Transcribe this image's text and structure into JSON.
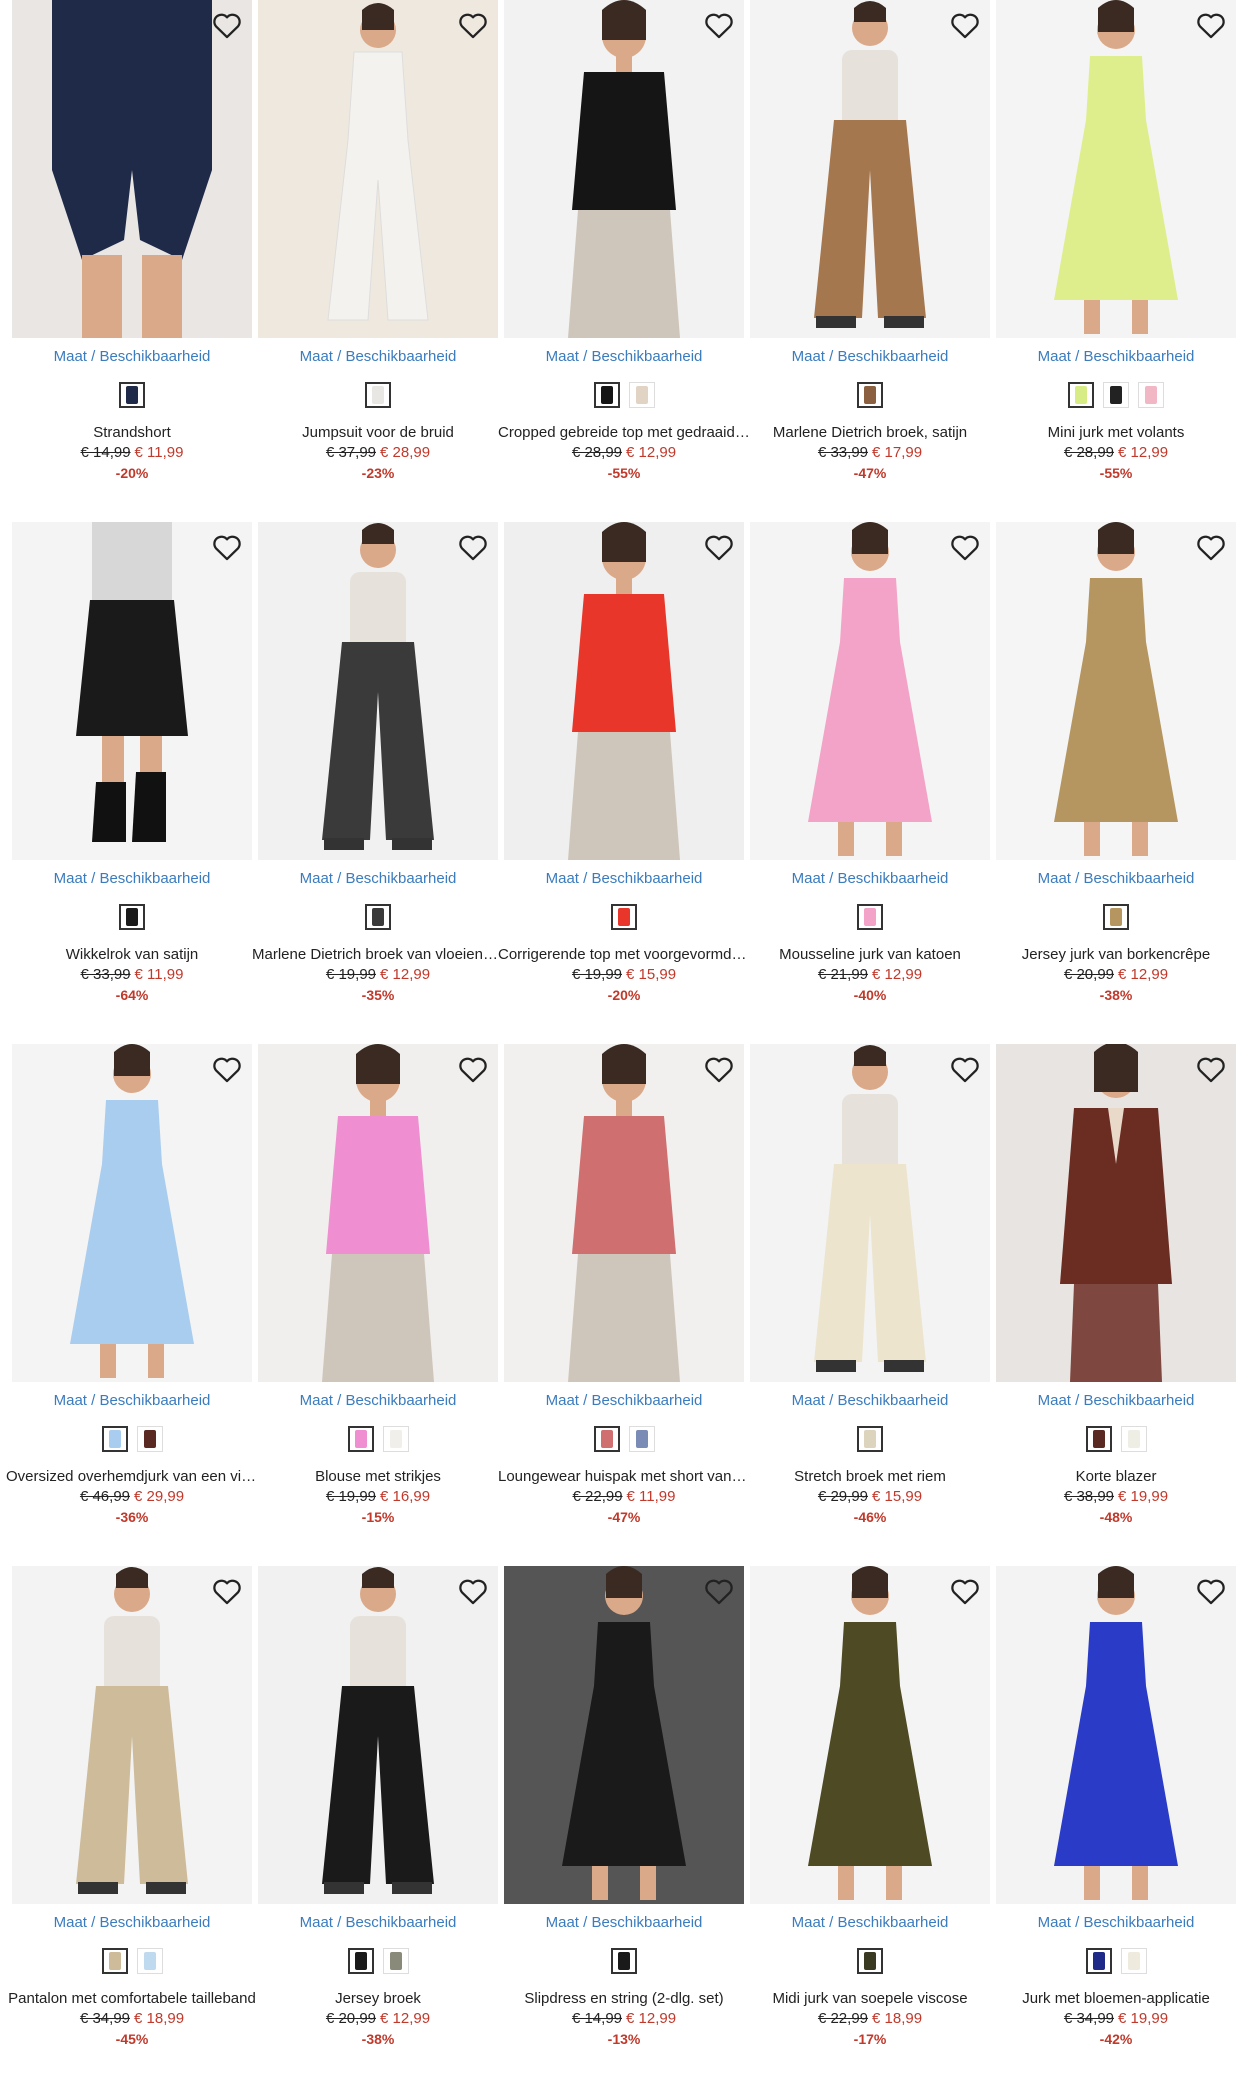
{
  "labels": {
    "size_link": "Maat / Beschikbaarheid"
  },
  "icons": {
    "wishlist": "heart-outline-icon"
  },
  "colors": {
    "link": "#3a7cbd",
    "sale": "#c0392b"
  },
  "products": [
    {
      "title": "Strandshort",
      "old_price": "€ 14,99",
      "new_price": "€ 11,99",
      "discount": "-20%",
      "bg": "#e9e6e3",
      "garment": "#1f2a48",
      "type": "shorts",
      "swatches": [
        "#1f2a48"
      ]
    },
    {
      "title": "Jumpsuit voor de bruid",
      "old_price": "€ 37,99",
      "new_price": "€ 28,99",
      "discount": "-23%",
      "bg": "#efe8df",
      "garment": "#f4f2ee",
      "type": "jumpsuit",
      "swatches": [
        "#e9e7e3"
      ]
    },
    {
      "title": "Cropped gebreide top met gedraaide details",
      "old_price": "€ 28,99",
      "new_price": "€ 12,99",
      "discount": "-55%",
      "bg": "#f2f2f2",
      "garment": "#151515",
      "type": "top",
      "swatches": [
        "#151515",
        "#e2d4c4"
      ]
    },
    {
      "title": "Marlene Dietrich broek, satijn",
      "old_price": "€ 33,99",
      "new_price": "€ 17,99",
      "discount": "-47%",
      "bg": "#f3f3f3",
      "garment": "#a5774f",
      "type": "pants",
      "swatches": [
        "#8a6040"
      ]
    },
    {
      "title": "Mini jurk met volants",
      "old_price": "€ 28,99",
      "new_price": "€ 12,99",
      "discount": "-55%",
      "bg": "#f4f4f4",
      "garment": "#dfee8c",
      "type": "dress",
      "swatches": [
        "#d8ec86",
        "#222222",
        "#f2b7c4"
      ]
    },
    {
      "title": "Wikkelrok van satijn",
      "old_price": "€ 33,99",
      "new_price": "€ 11,99",
      "discount": "-64%",
      "bg": "#f4f4f4",
      "garment": "#1a1a1a",
      "type": "skirt",
      "swatches": [
        "#1a1a1a"
      ]
    },
    {
      "title": "Marlene Dietrich broek van vloeiende viscose",
      "old_price": "€ 19,99",
      "new_price": "€ 12,99",
      "discount": "-35%",
      "bg": "#f1f1f1",
      "garment": "#3a3a3a",
      "type": "pants",
      "swatches": [
        "#3a3a3a"
      ]
    },
    {
      "title": "Corrigerende top met voorgevormde cups",
      "old_price": "€ 19,99",
      "new_price": "€ 15,99",
      "discount": "-20%",
      "bg": "#efefef",
      "garment": "#e8362a",
      "type": "top",
      "swatches": [
        "#e8362a"
      ]
    },
    {
      "title": "Mousseline jurk van katoen",
      "old_price": "€ 21,99",
      "new_price": "€ 12,99",
      "discount": "-40%",
      "bg": "#f4f4f4",
      "garment": "#f3a3c7",
      "type": "dress",
      "swatches": [
        "#f3a3c7"
      ]
    },
    {
      "title": "Jersey jurk van borkencrêpe",
      "old_price": "€ 20,99",
      "new_price": "€ 12,99",
      "discount": "-38%",
      "bg": "#f5f5f5",
      "garment": "#b59660",
      "type": "dress",
      "swatches": [
        "#b59660"
      ]
    },
    {
      "title": "Oversized overhemdjurk van een viscosemix",
      "old_price": "€ 46,99",
      "new_price": "€ 29,99",
      "discount": "-36%",
      "bg": "#f4f4f4",
      "garment": "#a9cdee",
      "type": "dress",
      "swatches": [
        "#a9cdee",
        "#5a2a22"
      ]
    },
    {
      "title": "Blouse met strikjes",
      "old_price": "€ 19,99",
      "new_price": "€ 16,99",
      "discount": "-15%",
      "bg": "#f0efed",
      "garment": "#ef8ed0",
      "type": "top",
      "swatches": [
        "#ef8ed0",
        "#f1efe9"
      ]
    },
    {
      "title": "Loungewear huispak met short van viscose",
      "old_price": "€ 22,99",
      "new_price": "€ 11,99",
      "discount": "-47%",
      "bg": "#f1f0ee",
      "garment": "#cf6f70",
      "type": "top",
      "swatches": [
        "#cf6f70",
        "#7a8bb5"
      ]
    },
    {
      "title": "Stretch broek met riem",
      "old_price": "€ 29,99",
      "new_price": "€ 15,99",
      "discount": "-46%",
      "bg": "#f3f3f3",
      "garment": "#ece4cd",
      "type": "pants",
      "swatches": [
        "#ddd4bd"
      ]
    },
    {
      "title": "Korte blazer",
      "old_price": "€ 38,99",
      "new_price": "€ 19,99",
      "discount": "-48%",
      "bg": "#e8e4e1",
      "garment": "#6b2c22",
      "type": "blazer",
      "swatches": [
        "#5a2a22",
        "#efeee5"
      ]
    },
    {
      "title": "Pantalon met comfortabele tailleband",
      "old_price": "€ 34,99",
      "new_price": "€ 18,99",
      "discount": "-45%",
      "bg": "#f3f3f3",
      "garment": "#cdbb9a",
      "type": "pants",
      "swatches": [
        "#cdbb9a",
        "#bfdaee"
      ]
    },
    {
      "title": "Jersey broek",
      "old_price": "€ 20,99",
      "new_price": "€ 12,99",
      "discount": "-38%",
      "bg": "#f1f1f1",
      "garment": "#1a1a1a",
      "type": "pants",
      "swatches": [
        "#1a1a1a",
        "#8a8a7a"
      ]
    },
    {
      "title": "Slipdress en string (2-dlg. set)",
      "old_price": "€ 14,99",
      "new_price": "€ 12,99",
      "discount": "-13%",
      "bg": "#555555",
      "garment": "#1a1a1a",
      "type": "dress",
      "swatches": [
        "#1a1a1a"
      ]
    },
    {
      "title": "Midi jurk van soepele viscose",
      "old_price": "€ 22,99",
      "new_price": "€ 18,99",
      "discount": "-17%",
      "bg": "#f4f4f4",
      "garment": "#4e4a23",
      "type": "dress",
      "swatches": [
        "#3a3a22"
      ]
    },
    {
      "title": "Jurk met bloemen-applicatie",
      "old_price": "€ 34,99",
      "new_price": "€ 19,99",
      "discount": "-42%",
      "bg": "#f3f3f3",
      "garment": "#2a3cc7",
      "type": "dress",
      "swatches": [
        "#1f2a88",
        "#eeeade"
      ]
    }
  ]
}
